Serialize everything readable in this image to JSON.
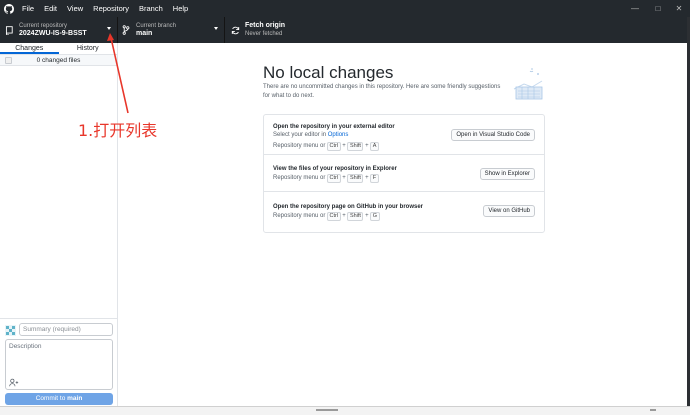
{
  "menubar": {
    "items": [
      "File",
      "Edit",
      "View",
      "Repository",
      "Branch",
      "Help"
    ],
    "window_controls": [
      "—",
      "□",
      "✕"
    ]
  },
  "toolbar": {
    "repo_label": "Current repository",
    "repo_name": "2024ZWU-IS-9-BSST",
    "branch_label": "Current branch",
    "branch_name": "main",
    "fetch_title": "Fetch origin",
    "fetch_sub": "Never fetched"
  },
  "sidebar": {
    "tabs": [
      "Changes",
      "History"
    ],
    "changed_files": "0 changed files",
    "summary_placeholder": "Summary (required)",
    "description_placeholder": "Description",
    "commit_prefix": "Commit to ",
    "commit_branch": "main"
  },
  "main": {
    "title": "No local changes",
    "subtitle": "There are no uncommitted changes in this repository. Here are some friendly suggestions for what to do next.",
    "rows": [
      {
        "title": "Open the repository in your external editor",
        "line1_prefix": "Select your editor in ",
        "line1_link": "Options",
        "menu_text": "Repository menu or",
        "keys": [
          "Ctrl",
          "Shift",
          "A"
        ],
        "button": "Open in Visual Studio Code"
      },
      {
        "title": "View the files of your repository in Explorer",
        "menu_text": "Repository menu or",
        "keys": [
          "Ctrl",
          "Shift",
          "F"
        ],
        "button": "Show in Explorer"
      },
      {
        "title": "Open the repository page on GitHub in your browser",
        "menu_text": "Repository menu or",
        "keys": [
          "Ctrl",
          "Shift",
          "G"
        ],
        "button": "View on GitHub"
      }
    ]
  },
  "annotation": {
    "text": "1.打开列表",
    "color": "#e8362a"
  },
  "colors": {
    "toolbar_bg": "#24292e",
    "accent": "#0366d6",
    "commit_button": "#6fa4e6"
  },
  "icons": {
    "app": "github-icon",
    "repo": "repository-icon",
    "branch": "git-branch-icon",
    "fetch": "sync-icon",
    "coauthor": "person-add-icon"
  }
}
